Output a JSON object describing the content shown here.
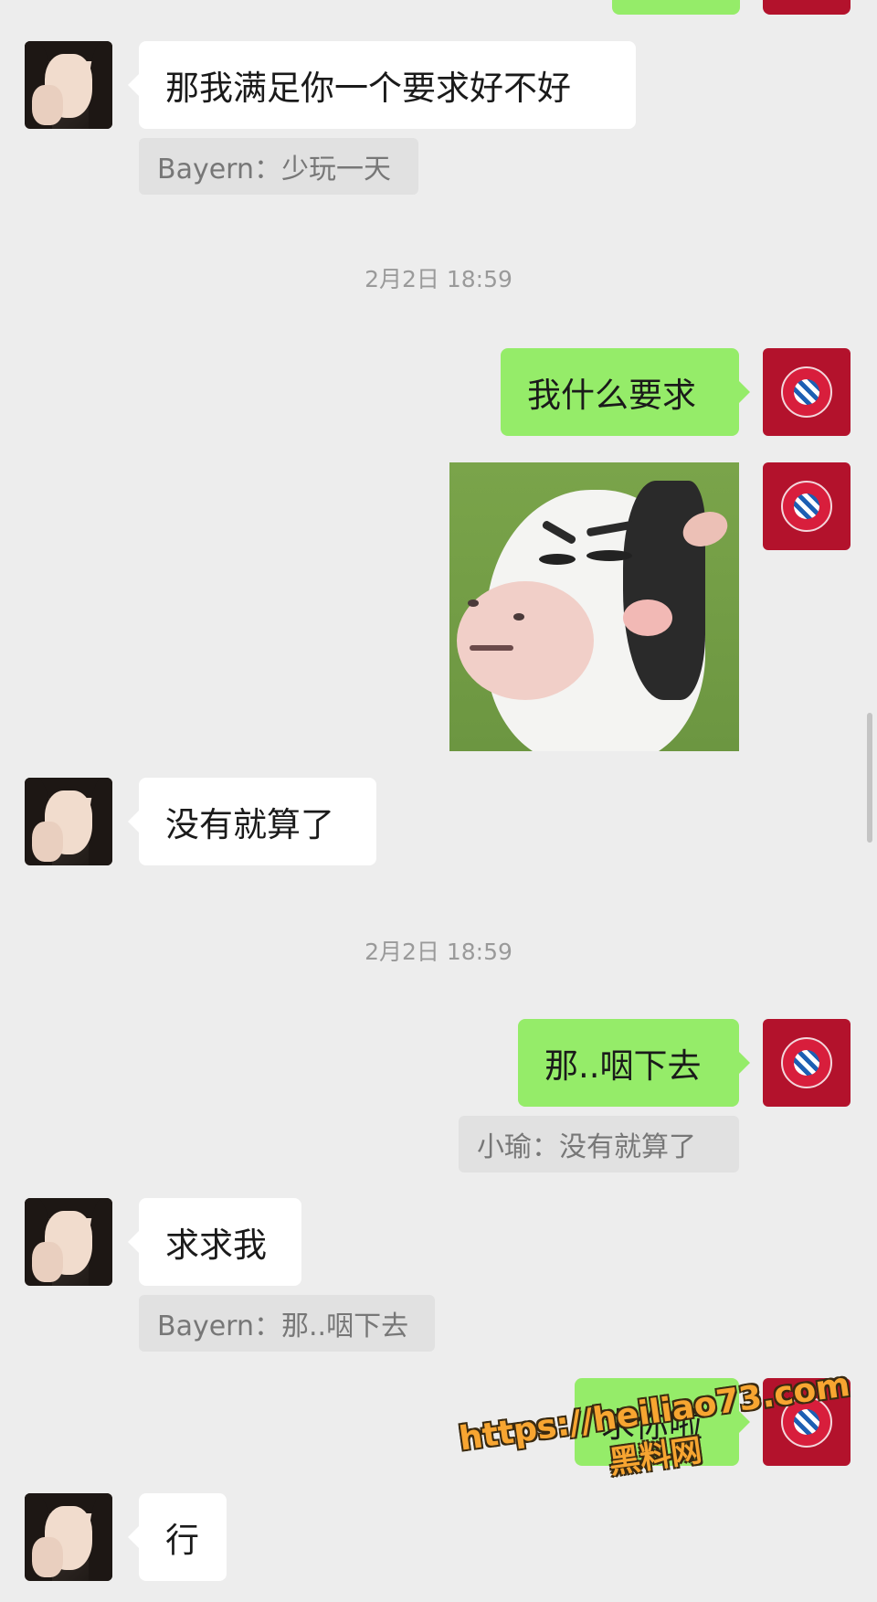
{
  "timestamps": [
    "2月2日 18:59",
    "2月2日 18:59"
  ],
  "messages": {
    "m1": "那我满足你一个要求好不好",
    "q1": "Bayern：少玩一天",
    "m2": "我什么要求",
    "m3": "没有就算了",
    "m4": "那..咽下去",
    "q2": "小瑜：没有就算了",
    "m5": "求求我",
    "q3": "Bayern：那..咽下去",
    "m6": "求你啦",
    "m7": "行"
  },
  "watermark": {
    "url": "https://heiliao73.com",
    "name": "黑料网"
  },
  "colors": {
    "background": "#ededed",
    "sent_bubble": "#95ec69",
    "received_bubble": "#ffffff",
    "quote_bg": "#e1e1e1",
    "bayern_avatar": "#b3122c",
    "watermark": "#f7a531"
  }
}
